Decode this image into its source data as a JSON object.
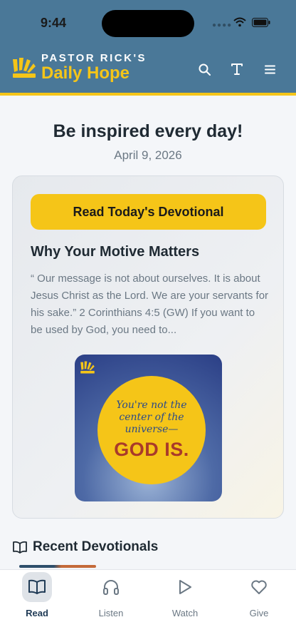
{
  "status_bar": {
    "time": "9:44"
  },
  "header": {
    "brand_top": "PASTOR RICK'S",
    "brand_bottom": "Daily Hope",
    "icons": [
      "search-icon",
      "text-size-icon",
      "menu-icon"
    ]
  },
  "hero": {
    "title": "Be inspired every day!",
    "date": "April 9, 2026"
  },
  "devotional": {
    "button_label": "Read Today's Devotional",
    "title": "Why Your Motive Matters",
    "excerpt": "“ Our message is not about ourselves. It is about Jesus Christ as the Lord. We are your servants for his sake.” 2 Corinthians 4:5 (GW) If you want to be used by God, you need to...",
    "image": {
      "script_text": "You're not the center of the universe—",
      "bold_text": "GOD IS."
    }
  },
  "recent": {
    "title": "Recent Devotionals"
  },
  "tabs": [
    {
      "label": "Read",
      "icon": "book-icon",
      "active": true
    },
    {
      "label": "Listen",
      "icon": "headphones-icon",
      "active": false
    },
    {
      "label": "Watch",
      "icon": "play-icon",
      "active": false
    },
    {
      "label": "Give",
      "icon": "heart-icon",
      "active": false
    }
  ],
  "colors": {
    "header_bg": "#4a7898",
    "accent_yellow": "#f5c518",
    "text_dark": "#1f2a33",
    "text_muted": "#6b7884"
  }
}
